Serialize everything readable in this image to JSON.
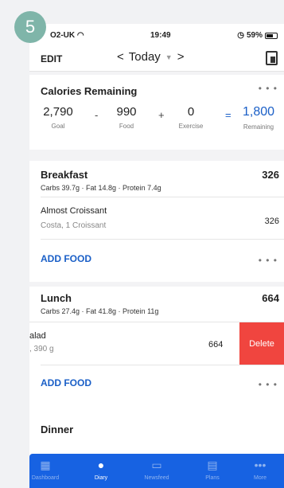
{
  "step_number": "5",
  "status_bar": {
    "carrier": "O2-UK",
    "time": "19:49",
    "battery": "59%"
  },
  "nav": {
    "edit": "EDIT",
    "date": "Today"
  },
  "calories": {
    "title": "Calories Remaining",
    "goal": {
      "value": "2,790",
      "label": "Goal"
    },
    "minus": "-",
    "food": {
      "value": "990",
      "label": "Food"
    },
    "plus": "+",
    "exercise": {
      "value": "0",
      "label": "Exercise"
    },
    "equals": "=",
    "remaining": {
      "value": "1,800",
      "label": "Remaining"
    }
  },
  "breakfast": {
    "title": "Breakfast",
    "total": "326",
    "macros": "Carbs 39.7g · Fat 14.8g · Protein 7.4g",
    "item": {
      "name": "Almost Croissant",
      "serving": "Costa, 1 Croissant",
      "calories": "326"
    },
    "add_food": "ADD FOOD"
  },
  "lunch": {
    "title": "Lunch",
    "total": "664",
    "macros": "Carbs 27.4g · Fat 41.8g · Protein 11g",
    "item": {
      "name": "alad",
      "serving": ", 390 g",
      "calories": "664",
      "delete": "Delete"
    },
    "add_food": "ADD FOOD"
  },
  "dinner": {
    "title": "Dinner"
  },
  "tabs": [
    {
      "label": "Dashboard",
      "icon": "grid-icon"
    },
    {
      "label": "Diary",
      "icon": "diary-icon"
    },
    {
      "label": "Newsfeed",
      "icon": "newsfeed-icon"
    },
    {
      "label": "Plans",
      "icon": "plans-icon"
    },
    {
      "label": "More",
      "icon": "more-icon"
    }
  ],
  "colors": {
    "accent": "#1a5fc7",
    "tabbar": "#1762e2",
    "delete": "#f0453f",
    "badge": "#7fb5a9"
  }
}
